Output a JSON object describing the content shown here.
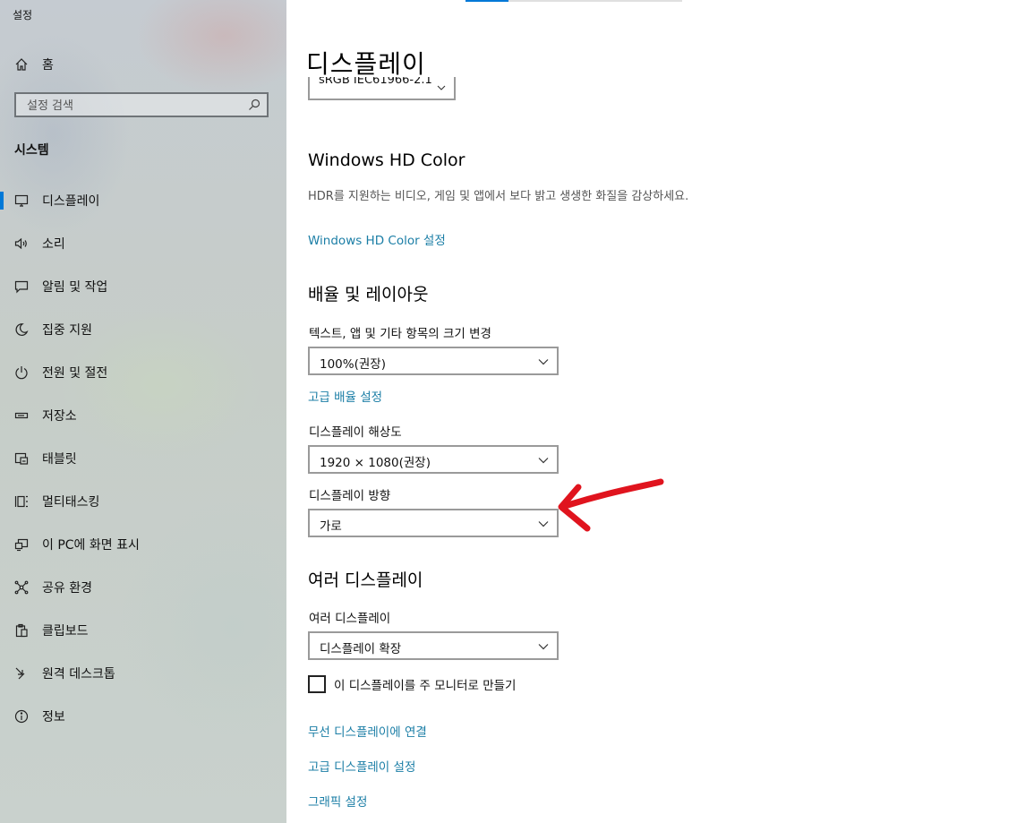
{
  "app": {
    "title": "설정"
  },
  "sidebar": {
    "home_label": "홈",
    "search_placeholder": "설정 검색",
    "section_label": "시스템",
    "items": [
      {
        "label": "디스플레이",
        "icon": "monitor-icon"
      },
      {
        "label": "소리",
        "icon": "speaker-icon"
      },
      {
        "label": "알림 및 작업",
        "icon": "notification-icon"
      },
      {
        "label": "집중 지원",
        "icon": "moon-icon"
      },
      {
        "label": "전원 및 절전",
        "icon": "power-icon"
      },
      {
        "label": "저장소",
        "icon": "storage-icon"
      },
      {
        "label": "태블릿",
        "icon": "tablet-icon"
      },
      {
        "label": "멀티태스킹",
        "icon": "multitasking-icon"
      },
      {
        "label": "이 PC에 화면 표시",
        "icon": "project-icon"
      },
      {
        "label": "공유 환경",
        "icon": "shared-experiences-icon"
      },
      {
        "label": "클립보드",
        "icon": "clipboard-icon"
      },
      {
        "label": "원격 데스크톱",
        "icon": "remote-desktop-icon"
      },
      {
        "label": "정보",
        "icon": "info-icon"
      }
    ],
    "active_index": 0
  },
  "main": {
    "page_title": "디스플레이",
    "color_profile_value": "sRGB IEC61966-2.1",
    "hd_color": {
      "heading": "Windows HD Color",
      "description": "HDR를 지원하는 비디오, 게임 및 앱에서 보다 밝고 생생한 화질을 감상하세요.",
      "link": "Windows HD Color 설정"
    },
    "scale_layout": {
      "heading": "배율 및 레이아웃",
      "scale_label": "텍스트, 앱 및 기타 항목의 크기 변경",
      "scale_value": "100%(권장)",
      "advanced_scale_link": "고급 배율 설정",
      "resolution_label": "디스플레이 해상도",
      "resolution_value": "1920 × 1080(권장)",
      "orientation_label": "디스플레이 방향",
      "orientation_value": "가로"
    },
    "multiple_displays": {
      "heading": "여러 디스플레이",
      "label": "여러 디스플레이",
      "value": "디스플레이 확장",
      "checkbox_label": "이 디스플레이를 주 모니터로 만들기",
      "checkbox_checked": false,
      "links": [
        "무선 디스플레이에 연결",
        "고급 디스플레이 설정",
        "그래픽 설정"
      ]
    }
  },
  "annotation": {
    "arrow_color": "#e0141e"
  },
  "colors": {
    "accent": "#0078d7",
    "link": "#1b7ea6"
  }
}
